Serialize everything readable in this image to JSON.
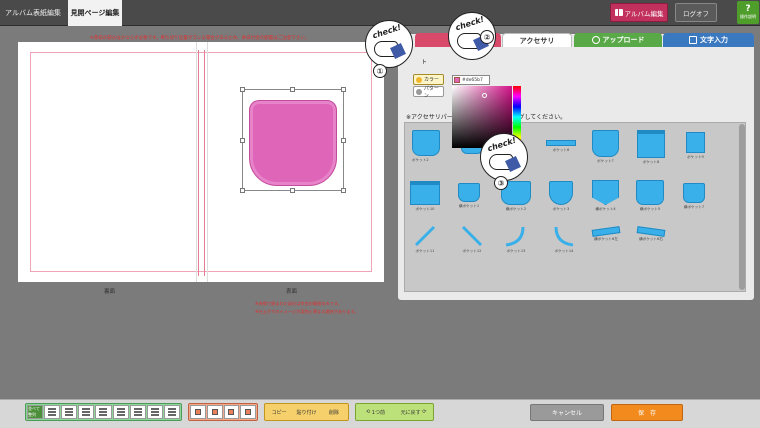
{
  "header": {
    "tab_cover": "アルバム表紙編集",
    "tab_inner": "見開ページ編集",
    "album_edit_label": "アルバム編集",
    "logoff_label": "ログオフ",
    "help_label": "操作説明"
  },
  "editor": {
    "notice_top": "※赤枠の部分はかならず必要です。断ち切り位置がズレる場合があるため、余白付近の配置はご注意下さい。",
    "label_left": "裏面",
    "label_right": "表面",
    "notice_bottom_1": "※赤線で囲まれた部分は余白の範囲のみです。",
    "notice_bottom_2": "※仕上がりのイメージが実物と異なる場合があります。",
    "pocket_color": "#de65b7"
  },
  "panel": {
    "tabs": [
      {
        "label": "ベ"
      },
      {
        "label": "アクセサリ"
      },
      {
        "label": "アップロード"
      },
      {
        "label": "文字入力"
      }
    ],
    "arrow": "ト",
    "color_option": "カラー",
    "pattern_option": "パターン",
    "instruction": "※アクセサリパー",
    "instruction_tail": "。作業画面にドラッグしてください。",
    "items": [
      {
        "label": ""
      },
      {
        "label": "ポケット2"
      },
      {
        "label": ""
      },
      {
        "label": "ポケット6"
      },
      {
        "label": "ポケット7"
      },
      {
        "label": "ポケット8"
      },
      {
        "label": "ポケット9"
      },
      {
        "label": "ポケット10"
      },
      {
        "label": "横ポケット1"
      },
      {
        "label": "横ポケット2"
      },
      {
        "label": "ポケット3"
      },
      {
        "label": "横ポケット4"
      },
      {
        "label": "横ポケット5"
      },
      {
        "label": "横ポケット7"
      },
      {
        "label": "ポケット11"
      },
      {
        "label": "ポケット12"
      },
      {
        "label": "ポケット13"
      },
      {
        "label": "ポケット14"
      },
      {
        "label": "横ポケット6左"
      },
      {
        "label": "横ポケット6右"
      }
    ],
    "accessory_color": "#3ab0ea"
  },
  "color_picker": {
    "hex": "#de65b7"
  },
  "callouts": [
    {
      "text": "check!",
      "number": "①"
    },
    {
      "text": "check!",
      "number": "②"
    },
    {
      "text": "check!",
      "number": "③"
    }
  ],
  "toolbar": {
    "arrange_label": "並べて整列",
    "copy": "コピー",
    "paste": "貼り付け",
    "delete": "削除",
    "undo": "1つ前",
    "redo": "元に戻す",
    "cancel": "キャンセル",
    "save": "保　存"
  }
}
